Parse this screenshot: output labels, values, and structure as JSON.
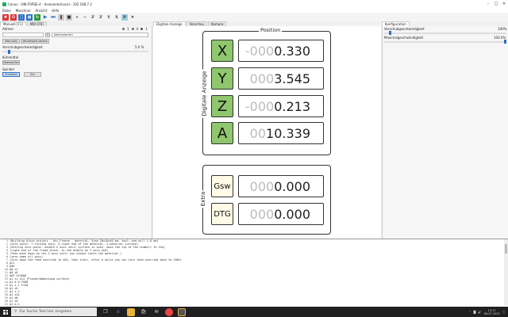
{
  "window": {
    "title": "Canus - UNI-FRÄSE-4 - InnoventorLocal - 192.168.7.2"
  },
  "menu": [
    "Datei",
    "Maschine",
    "Ansicht",
    "Hilfe"
  ],
  "left": {
    "tabs": [
      "Manuell [F1]",
      "MDI [F6]"
    ],
    "activ_label": "Aktiver",
    "radio_labels": [
      "1",
      "4",
      "1"
    ],
    "select_values": [
      "-",
      "kontinuierlich"
    ],
    "buttons_row1": [
      "Manually",
      "Verweilzeit setzen"
    ],
    "speed_label": "Vorschubgeschwindigkeit",
    "speed_value": "5.0 %",
    "speed_fraction": 0.05,
    "coolant_label": "Kühlmittel",
    "coolant_button": "Überspülen",
    "spindle_label": "Spindel",
    "spindle_buttons": [
      "Anhalten",
      "Ein"
    ]
  },
  "center": {
    "tabs": [
      "Digitale Anzeige",
      "Vorschau",
      "Kamera"
    ],
    "position_title": "Position",
    "digital_title": "Digitale Anzeige",
    "axes": [
      {
        "name": "X",
        "dim": "-000",
        "val": "0.330"
      },
      {
        "name": "Y",
        "dim": "000",
        "val": "3.545"
      },
      {
        "name": "Z",
        "dim": "-000",
        "val": "0.213"
      },
      {
        "name": "A",
        "dim": "00",
        "val": "10.339"
      }
    ],
    "extra_title": "Extra",
    "extras": [
      {
        "name": "Gsw",
        "dim": "000",
        "val": "0.000"
      },
      {
        "name": "DTG",
        "dim": "000",
        "val": "0.000"
      }
    ]
  },
  "right": {
    "tabs": [
      "Konfiguration"
    ],
    "feed_label": "Vorschubgeschwindigkeit",
    "feed_value": "100%",
    "feed_fraction": 1.0,
    "max_label": "Maximalgeschwindigkeit",
    "max_value": "100.0%",
    "max_fraction": 1.0
  },
  "console": {
    "lines": [
      "(Building block project - Uni-Fraese - material: Suan 20x20x40 mm, tool: end mill 1.6 mm)",
      "(zero point: T-turning axis, X-right end of the material, Z-material surface)",
      "(Setting zero point: middle X axis until surface is even, move the tip of the endmill to the)",
      "(right end of the frame block, to the middle on Y axis and)",
      "(Then move down on the Z axis until you almost touch the material.)",
      "(zero home all axis)",
      "(turn down the feed override to 40%, then start, after a while you can turn feed override back to 100%)",
      "g21",
      "g90",
      "g0 z1",
      "g0 x0",
      "m03 S15000",
      "g1 z1 x14 (Planen/Abdeckung surface)",
      "g1 a 0 F500",
      "g1 z-1 F150",
      "g1 z0",
      "g1 z-1",
      "g1 x14",
      "g1 a0",
      "g1 z0",
      "g1 a-1"
    ]
  },
  "taskbar": {
    "search_placeholder": "Zur Suche Text hier eingeben",
    "time": "13:17",
    "date": "06.07.2020"
  }
}
